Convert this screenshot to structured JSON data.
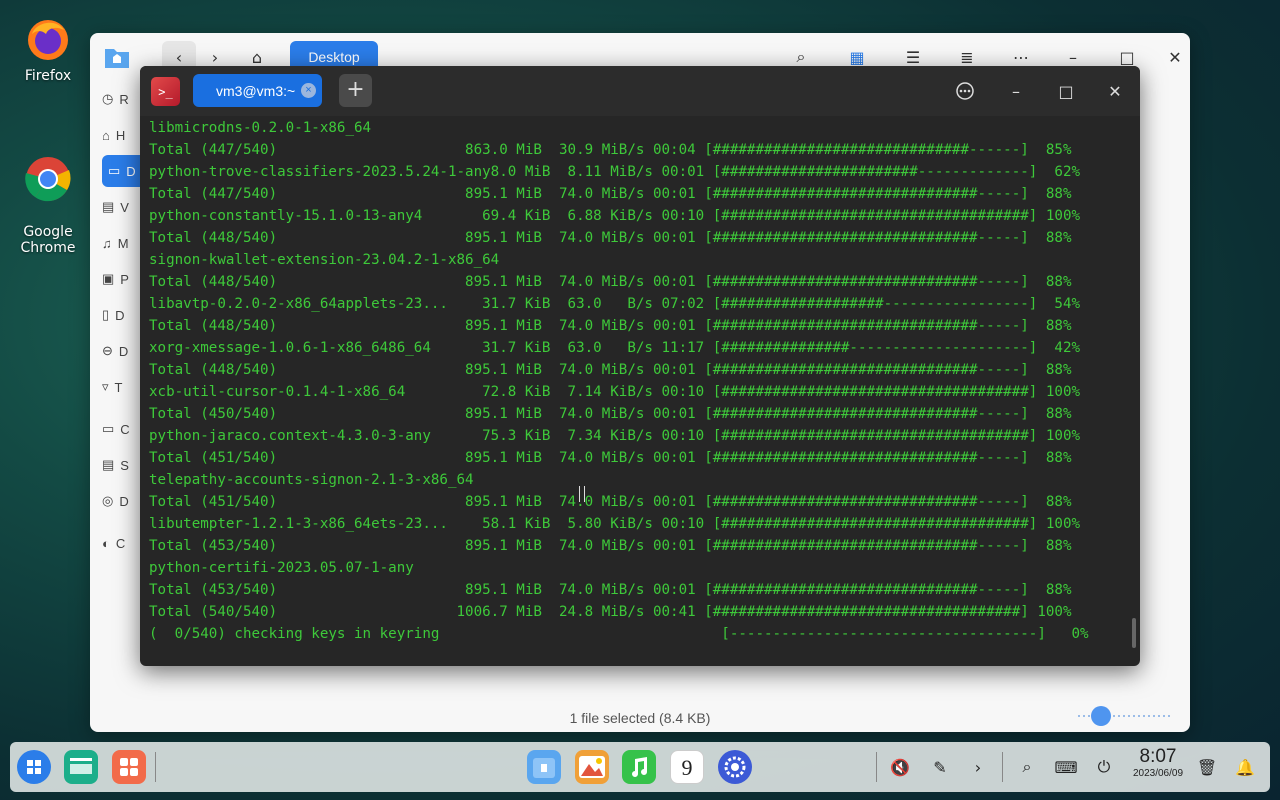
{
  "desktop": {
    "icons": [
      {
        "label": "Firefox"
      },
      {
        "label": "Google\nChrome"
      }
    ]
  },
  "file_manager": {
    "tab_label": "Desktop",
    "sidebar_letters": [
      "R",
      "H",
      "D",
      "V",
      "M",
      "P",
      "D",
      "D",
      "T",
      "C",
      "S",
      "D",
      "C"
    ],
    "status": "1 file selected (8.4 KB)"
  },
  "terminal": {
    "logo": ">_",
    "tab_label": "vm3@vm3:~",
    "tab_close": "×",
    "add_label": "+",
    "lines": [
      "libmicrodns-0.2.0-1-x86_64",
      "Total (447/540)                      863.0 MiB  30.9 MiB/s 00:04 [##############################------]  85%",
      "python-trove-classifiers-2023.5.24-1-any8.0 MiB  8.11 MiB/s 00:01 [#######################-------------]  62%",
      "Total (447/540)                      895.1 MiB  74.0 MiB/s 00:01 [###############################-----]  88%",
      "python-constantly-15.1.0-13-any4       69.4 KiB  6.88 KiB/s 00:10 [####################################] 100%",
      "Total (448/540)                      895.1 MiB  74.0 MiB/s 00:01 [###############################-----]  88%",
      "signon-kwallet-extension-23.04.2-1-x86_64",
      "Total (448/540)                      895.1 MiB  74.0 MiB/s 00:01 [###############################-----]  88%",
      "libavtp-0.2.0-2-x86_64applets-23...    31.7 KiB  63.0   B/s 07:02 [###################-----------------]  54%",
      "Total (448/540)                      895.1 MiB  74.0 MiB/s 00:01 [###############################-----]  88%",
      "xorg-xmessage-1.0.6-1-x86_6486_64      31.7 KiB  63.0   B/s 11:17 [###############---------------------]  42%",
      "Total (448/540)                      895.1 MiB  74.0 MiB/s 00:01 [###############################-----]  88%",
      "xcb-util-cursor-0.1.4-1-x86_64         72.8 KiB  7.14 KiB/s 00:10 [####################################] 100%",
      "Total (450/540)                      895.1 MiB  74.0 MiB/s 00:01 [###############################-----]  88%",
      "python-jaraco.context-4.3.0-3-any      75.3 KiB  7.34 KiB/s 00:10 [####################################] 100%",
      "Total (451/540)                      895.1 MiB  74.0 MiB/s 00:01 [###############################-----]  88%",
      "telepathy-accounts-signon-2.1-3-x86_64",
      "Total (451/540)                      895.1 MiB  74.0 MiB/s 00:01 [###############################-----]  88%",
      "libutempter-1.2.1-3-x86_64ets-23...    58.1 KiB  5.80 KiB/s 00:10 [####################################] 100%",
      "Total (453/540)                      895.1 MiB  74.0 MiB/s 00:01 [###############################-----]  88%",
      "python-certifi-2023.05.07-1-any",
      "Total (453/540)                      895.1 MiB  74.0 MiB/s 00:01 [###############################-----]  88%",
      "Total (540/540)                     1006.7 MiB  24.8 MiB/s 00:41 [####################################] 100%",
      "(  0/540) checking keys in keyring                                 [------------------------------------]   0%"
    ]
  },
  "dock": {
    "clock_time": "8:07",
    "clock_date": "2023/06/09",
    "calendar_day": "9"
  },
  "colors": {
    "terminal_text": "#3ec93a",
    "accent": "#2b7de9"
  }
}
